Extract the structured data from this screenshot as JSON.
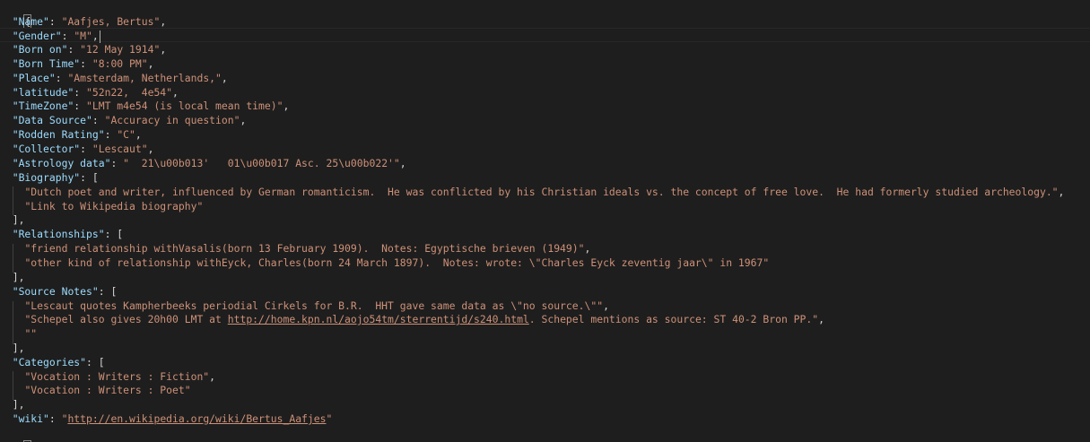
{
  "open_brace": "{",
  "close_brace": "}",
  "fields": {
    "name": {
      "key": "\"Name\"",
      "value": "\"Aafjes, Bertus\""
    },
    "gender": {
      "key": "\"Gender\"",
      "value": "\"M\""
    },
    "born_on": {
      "key": "\"Born on\"",
      "value": "\"12 May 1914\""
    },
    "born_time": {
      "key": "\"Born Time\"",
      "value": "\"8:00 PM\""
    },
    "place": {
      "key": "\"Place\"",
      "value": "\"Amsterdam, Netherlands,\""
    },
    "latitude": {
      "key": "\"latitude\"",
      "value": "\"52n22,  4e54\""
    },
    "timezone": {
      "key": "\"TimeZone\"",
      "value": "\"LMT m4e54 (is local mean time)\""
    },
    "data_source": {
      "key": "\"Data Source\"",
      "value": "\"Accuracy in question\""
    },
    "rodden_rating": {
      "key": "\"Rodden Rating\"",
      "value": "\"C\""
    },
    "collector": {
      "key": "\"Collector\"",
      "value": "\"Lescaut\""
    },
    "astrology_data": {
      "key": "\"Astrology data\"",
      "value": "\"  21\\u00b013'   01\\u00b017 Asc. 25\\u00b022'\""
    },
    "biography": {
      "key": "\"Biography\"",
      "items": [
        "\"Dutch poet and writer, influenced by German romanticism.  He was conflicted by his Christian ideals vs. the concept of free love.  He had formerly studied archeology.\"",
        "\"Link to Wikipedia biography\""
      ]
    },
    "relationships": {
      "key": "\"Relationships\"",
      "items": [
        "\"friend relationship withVasalis(born 13 February 1909).  Notes: Egyptische brieven (1949)\"",
        "\"other kind of relationship withEyck, Charles(born 24 March 1897).  Notes: wrote: \\\"Charles Eyck zeventig jaar\\\" in 1967\""
      ]
    },
    "source_notes": {
      "key": "\"Source Notes\"",
      "item0": "\"Lescaut quotes Kampherbeeks periodial Cirkels for B.R.  HHT gave same data as \\\"no source.\\\"\"",
      "item1_prefix": "\"Schepel also gives 20h00 LMT at ",
      "item1_link": "http://home.kpn.nl/aojo54tm/sterrentijd/s240.html",
      "item1_suffix": ". Schepel mentions as source: ST 40-2 Bron PP.\"",
      "item2": "\"\""
    },
    "categories": {
      "key": "\"Categories\"",
      "items": [
        "\"Vocation : Writers : Fiction\"",
        "\"Vocation : Writers : Poet\""
      ]
    },
    "wiki": {
      "key": "\"wiki\"",
      "link": "http://en.wikipedia.org/wiki/Bertus_Aafjes"
    }
  }
}
